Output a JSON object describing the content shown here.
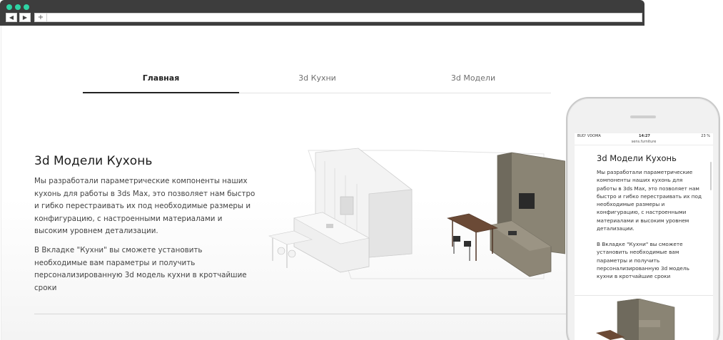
{
  "browser": {
    "back_label": "◀",
    "forward_label": "▶",
    "new_tab_label": "+"
  },
  "site": {
    "tabs": [
      "Главная",
      "3d Кухни",
      "3d Модели"
    ],
    "active_tab": "Главная",
    "hero": {
      "title": "3d Модели Кухонь",
      "paragraph1": "Мы разработали параметрические компоненты наших кухонь для работы в 3ds Max, это позволяет нам быстро и гибко перестраивать их под необходимые размеры и конфигурацию, с настроенными материалами и высоким уровнем детализации.",
      "paragraph2": "В Вкладке \"Кухни\" вы сможете установить необходимые вам параметры и получить персонализированную 3d модель кухни в кротчайшие сроки"
    }
  },
  "phone": {
    "status": {
      "carrier": "BUD' VDOMA",
      "time": "14:27",
      "battery": "23 %"
    },
    "url": "sens.furniture",
    "title": "3d Модели Кухонь",
    "paragraph1": "Мы разработали параметрические компоненты наших кухонь для работы в 3ds Max, это позволяет нам быстро и гибко перестраивать их под необходимые размеры и конфигурацию, с настроенными материалами и высоким уровнем детализации.",
    "paragraph2": "В Вкладке \"Кухни\" вы сможете установить необходимые вам параметры и получить персонализированную 3d модель кухни в кротчайшие сроки"
  },
  "colors": {
    "accent_dots": "#2ed3a4",
    "browser_bar": "#3d3d3d",
    "active_tab": "#222222",
    "kitchen_white": "#e9e9e9",
    "kitchen_taupe": "#8a8474",
    "wood": "#6b4a36"
  }
}
